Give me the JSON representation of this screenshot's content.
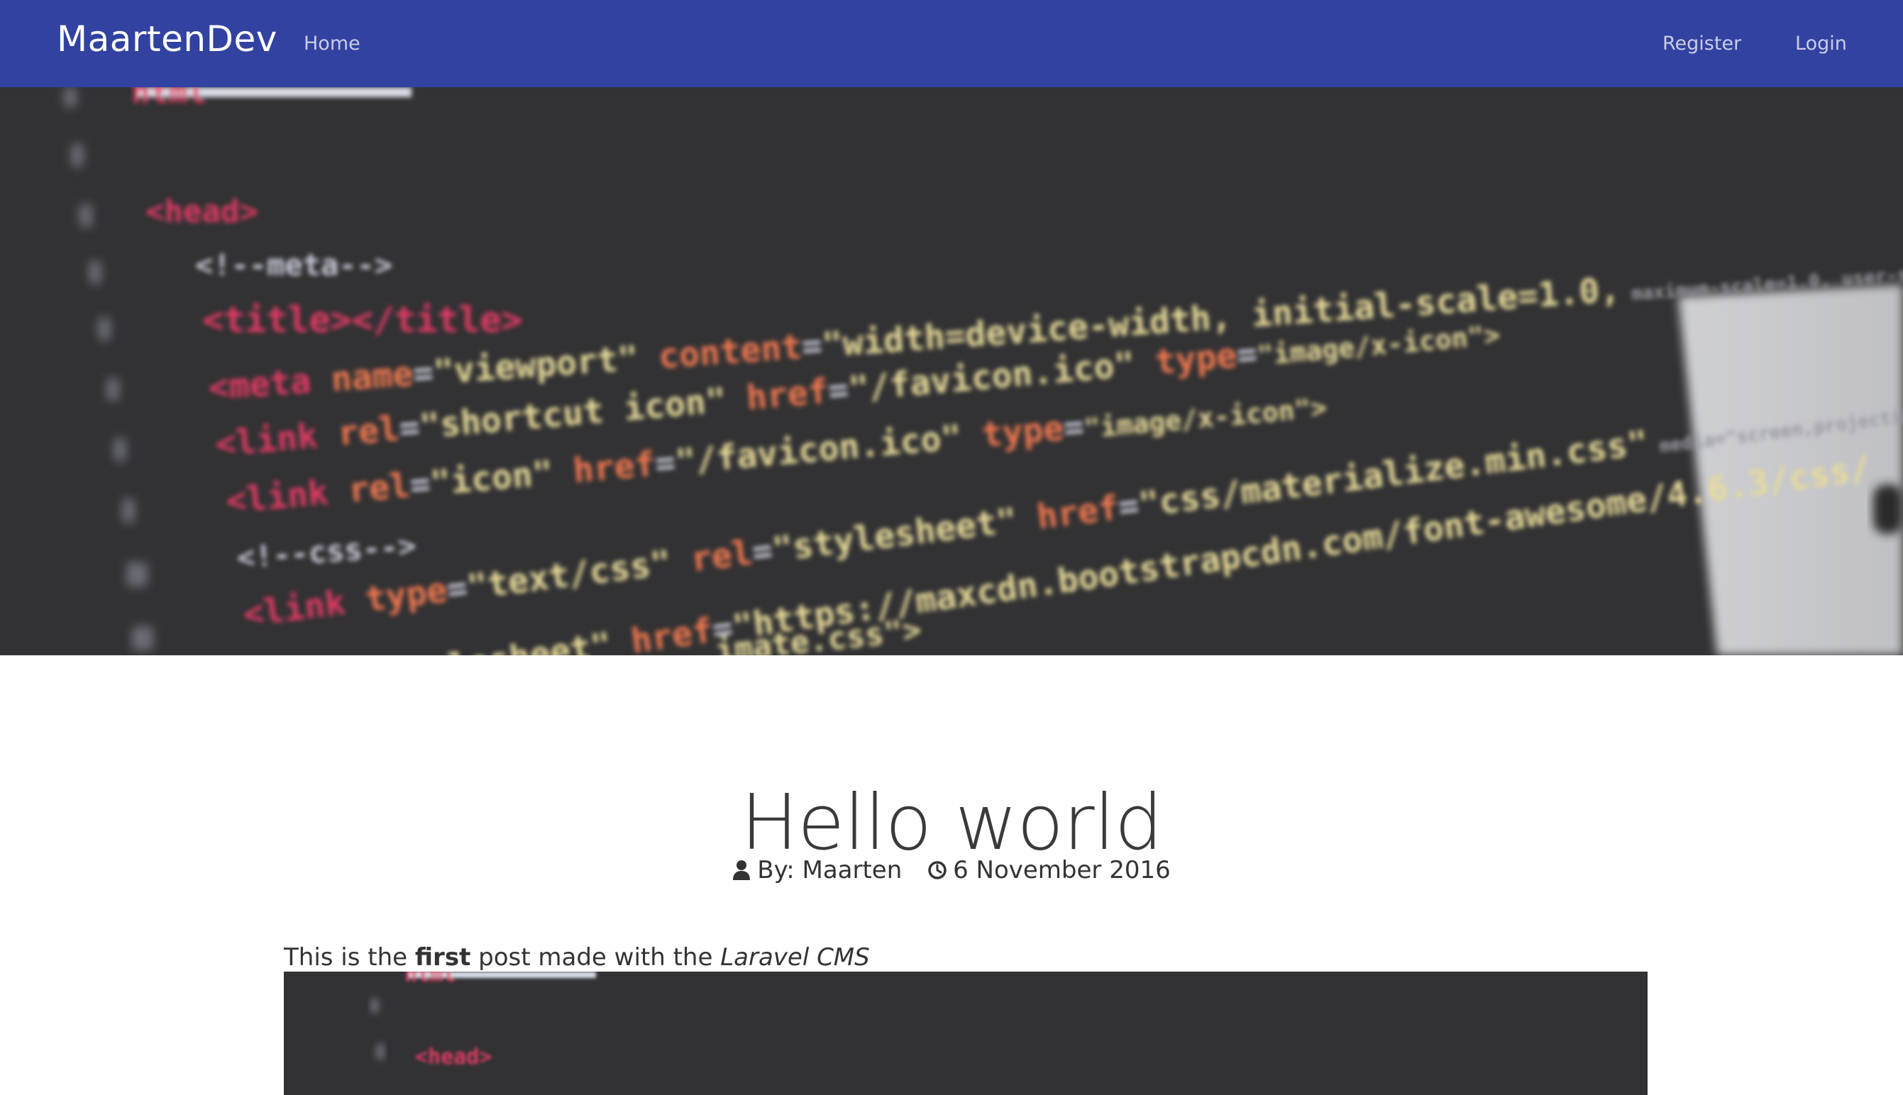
{
  "navbar": {
    "brand": "MaartenDev",
    "home": "Home",
    "register": "Register",
    "login": "Login",
    "background": "#3242a0"
  },
  "hero": {
    "image": "blurred-html-code-photo",
    "background": "#323234"
  },
  "post": {
    "title": "Hello world",
    "author_label": "By: Maarten",
    "author_icon": "user-icon",
    "date": "6 November 2016",
    "date_icon": "clock-icon",
    "body_prefix": "This is the ",
    "body_bold": "first",
    "body_middle": " post made with the ",
    "body_italic": "Laravel CMS",
    "image": "blurred-html-code-photo"
  }
}
